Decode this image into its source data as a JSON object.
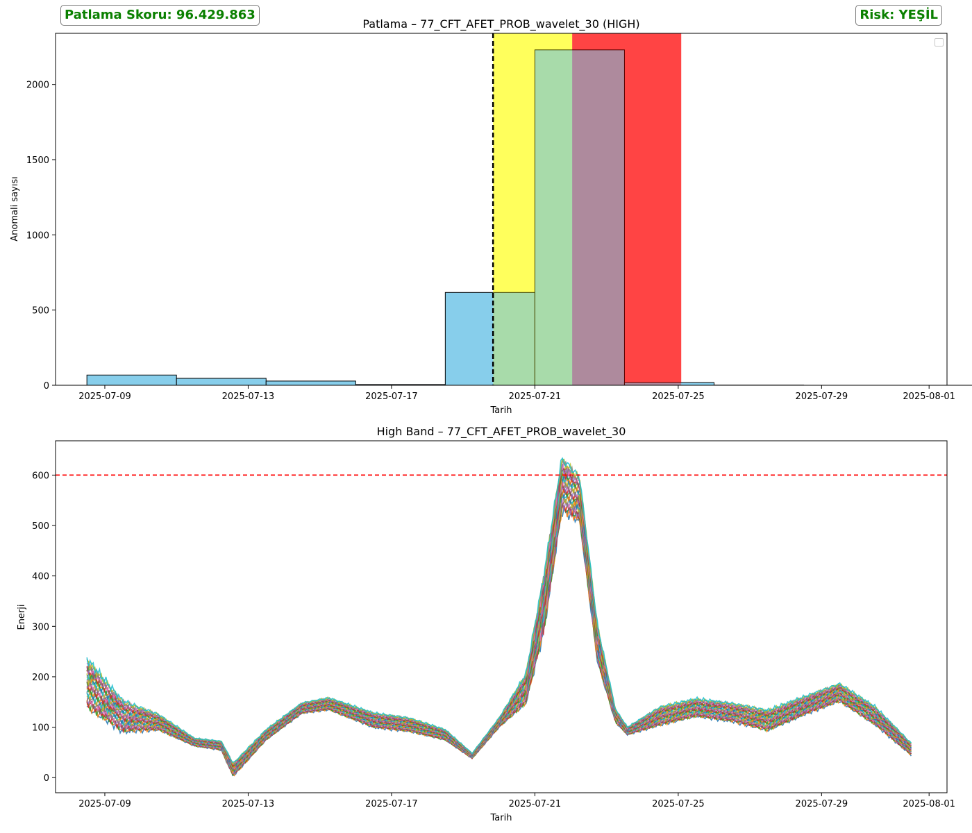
{
  "header": {
    "score_label": "Patlama Skoru: 96.429.863",
    "risk_label": "Risk: YEŞİL",
    "accent_color": "#0a8000"
  },
  "chart_data": [
    {
      "type": "bar",
      "title": "Patlama – 77_CFT_AFET_PROB_wavelet_30 (HIGH)",
      "xlabel": "Tarih",
      "ylabel": "Anomali sayısı",
      "x_ticks": [
        "2025-07-09",
        "2025-07-13",
        "2025-07-17",
        "2025-07-21",
        "2025-07-25",
        "2025-07-29",
        "2025-08-01"
      ],
      "xlim": [
        "2025-07-07T15:00",
        "2025-08-01T12:00"
      ],
      "y_ticks": [
        0,
        500,
        1000,
        1500,
        2000
      ],
      "ylim": [
        0,
        2340
      ],
      "bar_color": "#87ceeb",
      "bins": [
        {
          "start": "2025-07-08T12:00",
          "end": "2025-07-11T00:00",
          "count": 68
        },
        {
          "start": "2025-07-11T00:00",
          "end": "2025-07-13T12:00",
          "count": 46
        },
        {
          "start": "2025-07-13T12:00",
          "end": "2025-07-16T00:00",
          "count": 28
        },
        {
          "start": "2025-07-16T00:00",
          "end": "2025-07-18T12:00",
          "count": 5
        },
        {
          "start": "2025-07-18T12:00",
          "end": "2025-07-21T00:00",
          "count": 617
        },
        {
          "start": "2025-07-21T00:00",
          "end": "2025-07-23T12:00",
          "count": 2230
        },
        {
          "start": "2025-07-23T12:00",
          "end": "2025-07-26T00:00",
          "count": 18
        },
        {
          "start": "2025-07-26T00:00",
          "end": "2025-07-28T12:00",
          "count": 1
        },
        {
          "start": "2025-07-28T12:00",
          "end": "2025-07-31T00:00",
          "count": 0
        },
        {
          "start": "2025-07-31T00:00",
          "end": "2025-08-02T12:00",
          "count": 0
        }
      ],
      "marker_line": {
        "date": "2025-07-19T20:00",
        "style": "dashed",
        "color": "#000000"
      },
      "shaded_spans": [
        {
          "start": "2025-07-19T20:00",
          "end": "2025-07-22T01:00",
          "color": "#ffff00",
          "alpha": 0.5
        },
        {
          "start": "2025-07-22T01:00",
          "end": "2025-07-25T02:00",
          "color": "#ff0000",
          "alpha": 0.6
        }
      ],
      "legend": "top-right (empty)",
      "grid": false
    },
    {
      "type": "line",
      "title": "High Band – 77_CFT_AFET_PROB_wavelet_30",
      "xlabel": "Tarih",
      "ylabel": "Enerji",
      "x_ticks": [
        "2025-07-09",
        "2025-07-13",
        "2025-07-17",
        "2025-07-21",
        "2025-07-25",
        "2025-07-29",
        "2025-08-01"
      ],
      "xlim": [
        "2025-07-07T15:00",
        "2025-08-01T12:00"
      ],
      "y_ticks": [
        0,
        100,
        200,
        300,
        400,
        500,
        600
      ],
      "ylim": [
        -30,
        668
      ],
      "threshold": {
        "value": 600,
        "style": "dashed",
        "color": "#ff0000"
      },
      "series_count": 30,
      "series_colors": [
        "#1f77b4",
        "#ff7f0e",
        "#2ca02c",
        "#d62728",
        "#9467bd",
        "#8c564b",
        "#e377c2",
        "#7f7f7f",
        "#bcbd22",
        "#17becf"
      ],
      "envelope": {
        "x": [
          "2025-07-08T12:00",
          "2025-07-09T12:00",
          "2025-07-10T12:00",
          "2025-07-11T12:00",
          "2025-07-12T06:00",
          "2025-07-12T14:00",
          "2025-07-13T12:00",
          "2025-07-14T12:00",
          "2025-07-15T06:00",
          "2025-07-16T12:00",
          "2025-07-17T12:00",
          "2025-07-18T12:00",
          "2025-07-19T06:00",
          "2025-07-20T00:00",
          "2025-07-20T18:00",
          "2025-07-21T06:00",
          "2025-07-21T18:00",
          "2025-07-22T06:00",
          "2025-07-22T18:00",
          "2025-07-23T06:00",
          "2025-07-23T14:00",
          "2025-07-24T12:00",
          "2025-07-25T12:00",
          "2025-07-26T12:00",
          "2025-07-27T12:00",
          "2025-07-28T12:00",
          "2025-07-29T12:00",
          "2025-07-30T12:00",
          "2025-07-31T12:00"
        ],
        "low": [
          140,
          92,
          95,
          63,
          55,
          3,
          75,
          128,
          135,
          100,
          92,
          75,
          38,
          100,
          148,
          290,
          530,
          510,
          230,
          110,
          85,
          105,
          122,
          112,
          94,
          125,
          152,
          105,
          45
        ],
        "high": [
          235,
          152,
          125,
          78,
          72,
          28,
          95,
          148,
          158,
          128,
          118,
          95,
          48,
          118,
          205,
          400,
          633,
          595,
          300,
          135,
          100,
          140,
          156,
          147,
          133,
          160,
          186,
          140,
          68
        ]
      }
    }
  ]
}
